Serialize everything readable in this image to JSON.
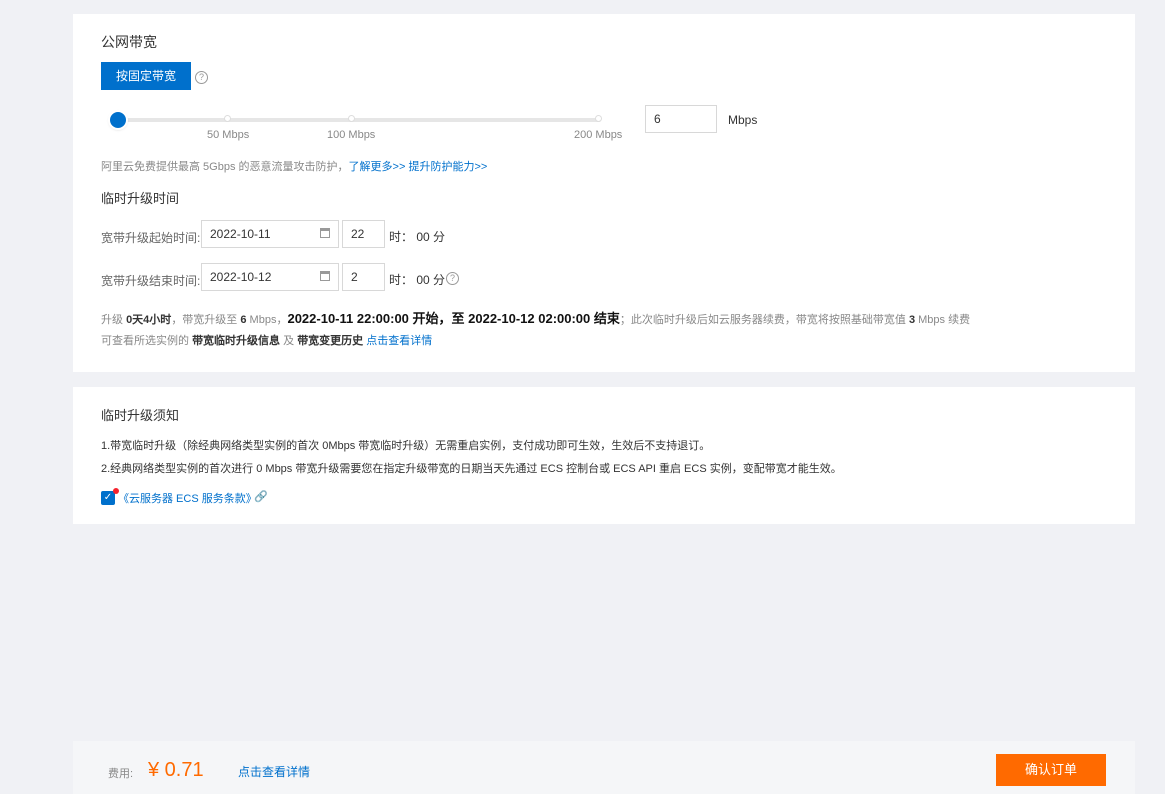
{
  "bandwidth": {
    "title": "公网带宽",
    "mode_button": "按固定带宽",
    "help_icon": "question-circle-icon",
    "slider": {
      "value": 6,
      "max": 200,
      "tick_labels": [
        "50 Mbps",
        "100 Mbps",
        "200 Mbps"
      ]
    },
    "input_value": "6",
    "unit": "Mbps",
    "ddos_text": "阿里云免费提供最高 5Gbps 的恶意流量攻击防护，",
    "learn_more_link": "了解更多>>",
    "upgrade_protection_link": "提升防护能力>>"
  },
  "temp_upgrade": {
    "title": "临时升级时间",
    "start_label": "宽带升级起始时间:",
    "start_date": "2022-10-11",
    "start_hour": "22",
    "end_label": "宽带升级结束时间:",
    "end_date": "2022-10-12",
    "end_hour": "2",
    "time_suffix": "时： 00 分",
    "calendar_icon": "calendar-icon"
  },
  "summary": {
    "line1": {
      "p1": "升级 ",
      "duration": "0天4小时",
      "p2": "，带宽升级至 ",
      "bw": "6",
      "p3": " Mbps，",
      "period": "2022-10-11 22:00:00 开始，至 2022-10-12 02:00:00 结束",
      "p4": "；此次临时升级后如云服务器续费，带宽将按照基础带宽值 ",
      "base_bw": "3",
      "p5": " Mbps 续费"
    },
    "line2": {
      "p1": "可查看所选实例的 ",
      "info": "带宽临时升级信息",
      "p2": " 及 ",
      "history": "带宽变更历史",
      "link": " 点击查看详情"
    }
  },
  "notice": {
    "title": "临时升级须知",
    "items": [
      "1.带宽临时升级（除经典网络类型实例的首次 0Mbps 带宽临时升级）无需重启实例，支付成功即可生效，生效后不支持退订。",
      "2.经典网络类型实例的首次进行 0 Mbps 带宽升级需要您在指定升级带宽的日期当天先通过 ECS 控制台或 ECS API 重启 ECS 实例，变配带宽才能生效。"
    ],
    "agreement_link": "《云服务器 ECS 服务条款》",
    "agreement_checked": true,
    "link_icon": "link-icon"
  },
  "footer": {
    "fee_label": "费用:",
    "price": "¥ 0.71",
    "details_link": "点击查看详情",
    "confirm_button": "确认订单"
  },
  "colors": {
    "primary": "#0070cc",
    "orange": "#ff6a00",
    "danger": "#f5222d"
  }
}
